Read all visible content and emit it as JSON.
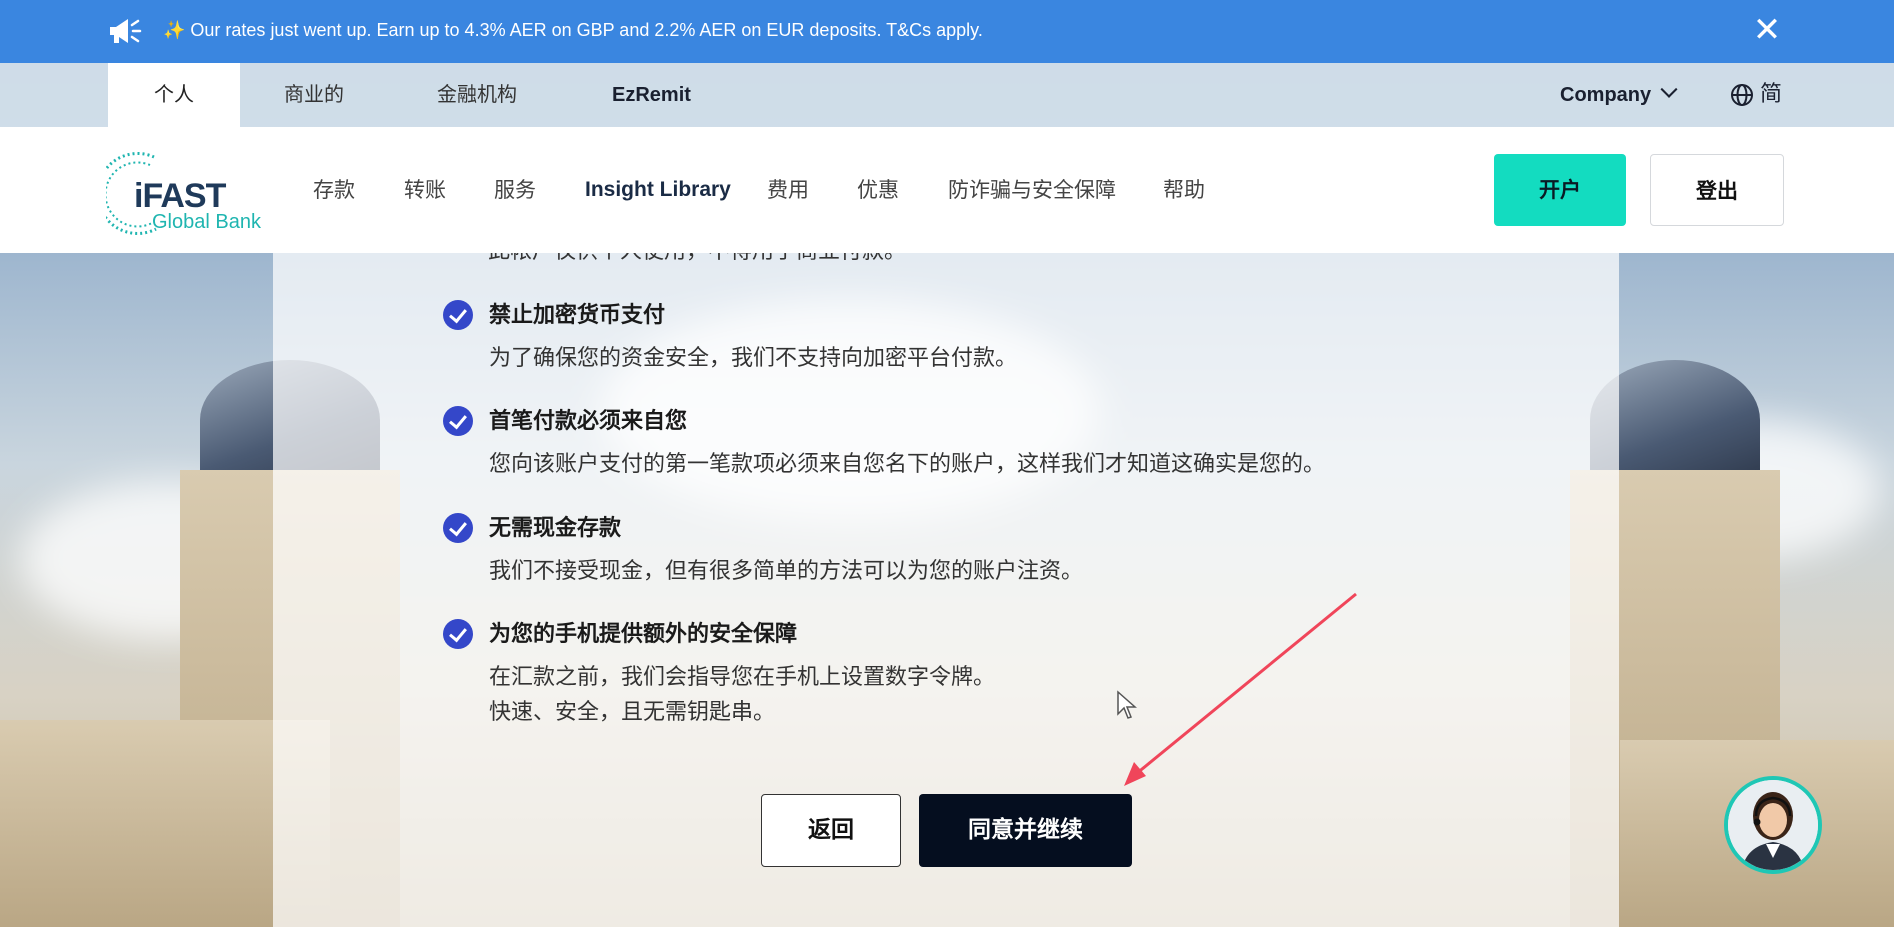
{
  "announcement": {
    "icon": "megaphone-icon",
    "text": "✨ Our rates just went up. Earn up to 4.3% AER on GBP and 2.2% AER on EUR deposits. T&Cs apply.",
    "close_icon": "close-icon"
  },
  "segments": {
    "items": [
      "个人",
      "商业的",
      "金融机构",
      "EzRemit"
    ],
    "active": "个人",
    "company_label": "Company",
    "language_label": "简"
  },
  "header": {
    "logo_main": "iFAST",
    "logo_sub": "Global Bank",
    "nav": [
      "存款",
      "转账",
      "服务",
      "Insight Library",
      "费用",
      "优惠",
      "防诈骗与安全保障",
      "帮助"
    ],
    "open_account": "开户",
    "logout": "登出",
    "accent_color": "#13dcc0"
  },
  "content": {
    "cut_text": "此帐户仅供个人使用，不得用于商业付款。",
    "items": [
      {
        "title": "禁止加密货币支付",
        "desc": [
          "为了确保您的资金安全，我们不支持向加密平台付款。"
        ]
      },
      {
        "title": "首笔付款必须来自您",
        "desc": [
          "您向该账户支付的第一笔款项必须来自您名下的账户，这样我们才知道这确实是您的。"
        ]
      },
      {
        "title": "无需现金存款",
        "desc": [
          "我们不接受现金，但有很多简单的方法可以为您的账户注资。"
        ]
      },
      {
        "title": "为您的手机提供额外的安全保障",
        "desc": [
          "在汇款之前，我们会指导您在手机上设置数字令牌。",
          "快速、安全，且无需钥匙串。"
        ]
      }
    ],
    "back": "返回",
    "agree": "同意并继续"
  }
}
